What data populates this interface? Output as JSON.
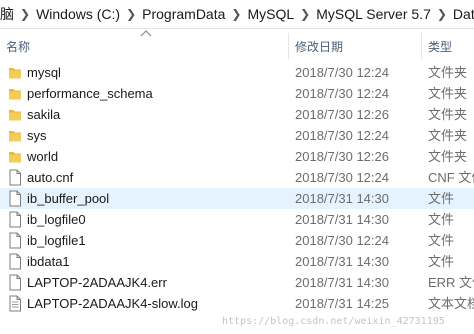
{
  "breadcrumb": {
    "items": [
      "脑",
      "Windows (C:)",
      "ProgramData",
      "MySQL",
      "MySQL Server 5.7",
      "Data"
    ]
  },
  "columns": {
    "name": "名称",
    "date": "修改日期",
    "type": "类型"
  },
  "files": [
    {
      "name": "mysql",
      "date": "2018/7/30 12:24",
      "type": "文件夹",
      "icon": "folder-icon"
    },
    {
      "name": "performance_schema",
      "date": "2018/7/30 12:24",
      "type": "文件夹",
      "icon": "folder-icon"
    },
    {
      "name": "sakila",
      "date": "2018/7/30 12:26",
      "type": "文件夹",
      "icon": "folder-icon"
    },
    {
      "name": "sys",
      "date": "2018/7/30 12:24",
      "type": "文件夹",
      "icon": "folder-icon"
    },
    {
      "name": "world",
      "date": "2018/7/30 12:26",
      "type": "文件夹",
      "icon": "folder-icon"
    },
    {
      "name": "auto.cnf",
      "date": "2018/7/30 12:24",
      "type": "CNF 文件",
      "icon": "file-icon"
    },
    {
      "name": "ib_buffer_pool",
      "date": "2018/7/31 14:30",
      "type": "文件",
      "icon": "file-icon",
      "selected": true
    },
    {
      "name": "ib_logfile0",
      "date": "2018/7/31 14:30",
      "type": "文件",
      "icon": "file-icon"
    },
    {
      "name": "ib_logfile1",
      "date": "2018/7/30 12:24",
      "type": "文件",
      "icon": "file-icon"
    },
    {
      "name": "ibdata1",
      "date": "2018/7/31 14:30",
      "type": "文件",
      "icon": "file-icon"
    },
    {
      "name": "LAPTOP-2ADAAJK4.err",
      "date": "2018/7/31 14:30",
      "type": "ERR 文件",
      "icon": "file-icon"
    },
    {
      "name": "LAPTOP-2ADAAJK4-slow.log",
      "date": "2018/7/31 14:25",
      "type": "文本文档",
      "icon": "text-file-icon"
    }
  ],
  "watermark": "https://blog.csdn.net/weixin_42731195",
  "colors": {
    "folder": "#e8b93c",
    "selection": "#e5f3ff",
    "header_text": "#4c607a"
  }
}
